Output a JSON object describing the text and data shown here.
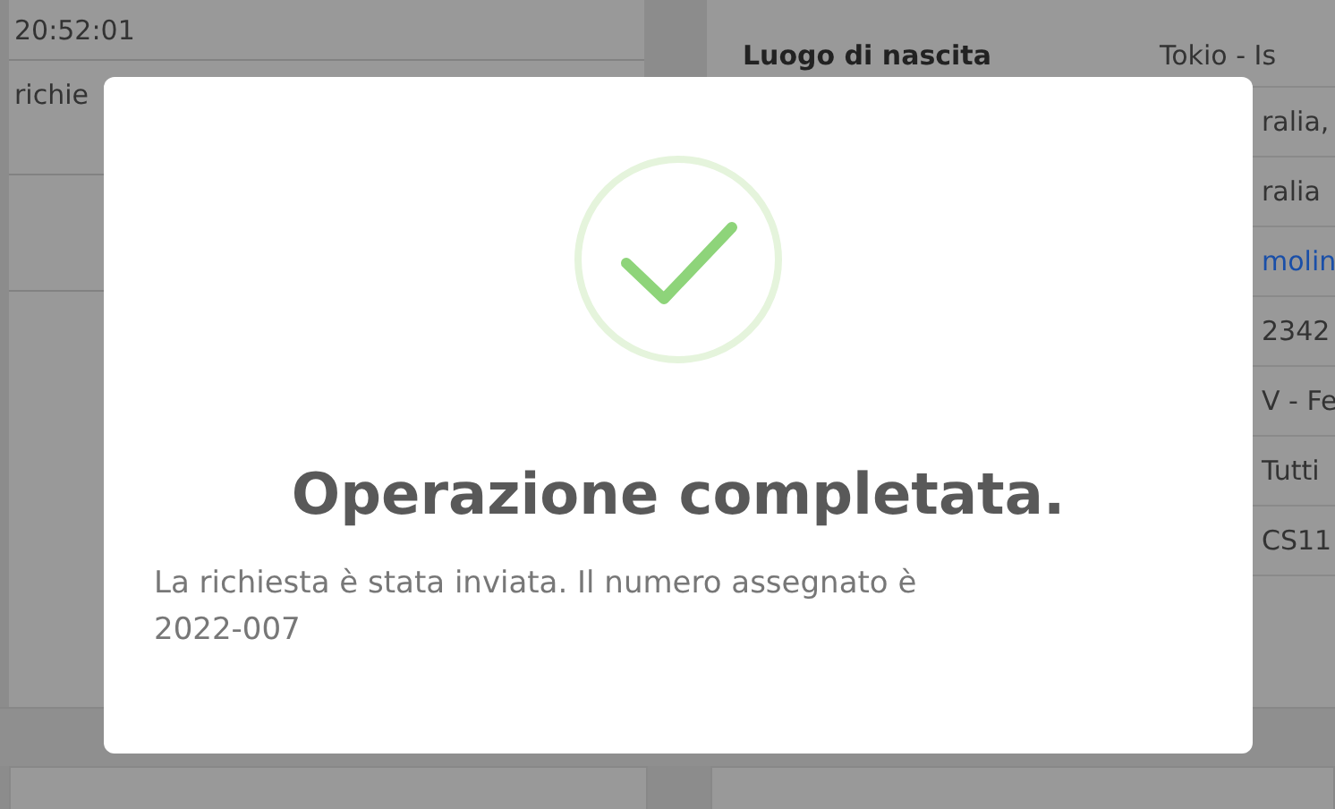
{
  "left_panel": {
    "time": "20:52:01",
    "text": "richie"
  },
  "right_panel": {
    "rows": [
      {
        "label": "Luogo di nascita",
        "value": "Tokio - Is",
        "kind": "text"
      },
      {
        "label": "",
        "value": "ralia,",
        "kind": "text"
      },
      {
        "label": "",
        "value": "ralia",
        "kind": "text"
      },
      {
        "label": "",
        "value": "molin",
        "kind": "link"
      },
      {
        "label": "",
        "value": "2342",
        "kind": "text"
      },
      {
        "label": "",
        "value": "V - Fe",
        "kind": "text"
      },
      {
        "label": "",
        "value": "Tutti",
        "kind": "text"
      },
      {
        "label": "",
        "value": "CS11",
        "kind": "text"
      }
    ]
  },
  "modal": {
    "title": "Operazione completata.",
    "message": "La richiesta è stata inviata. Il numero assegnato è 2022-007"
  }
}
